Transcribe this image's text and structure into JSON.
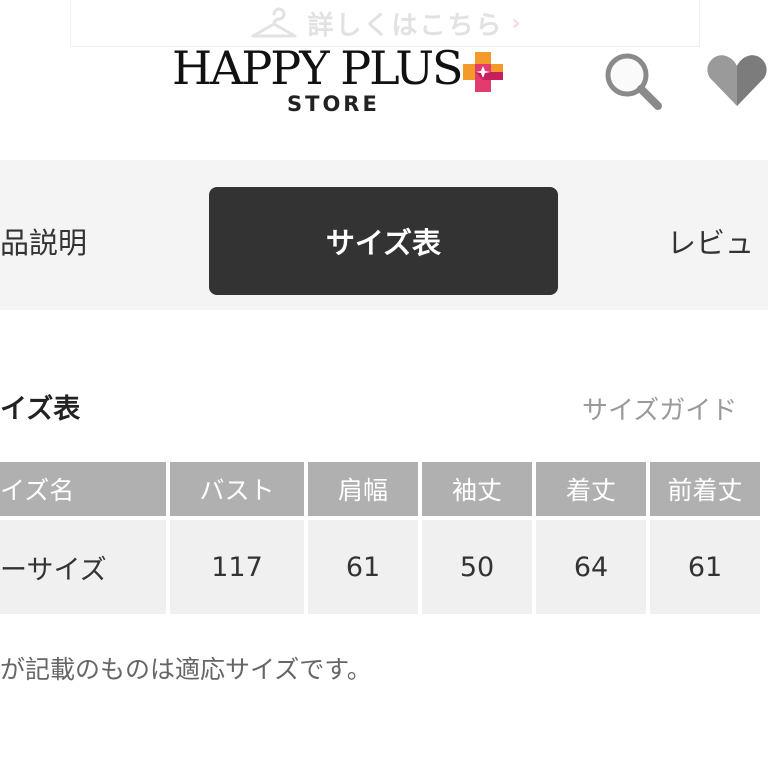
{
  "banner": {
    "text": "詳しくはこちら",
    "arrow": "›"
  },
  "header": {
    "logo_main": "HAPPY PLUS",
    "logo_sub": "STORE",
    "brand_colors": {
      "plus_orange": "#f39a2b",
      "plus_pink": "#e23c6e",
      "plus_magenta": "#c51f5d"
    }
  },
  "tabs": {
    "items": [
      {
        "label": "品説明",
        "active": false
      },
      {
        "label": "サイズ表",
        "active": true
      },
      {
        "label": "レビュ",
        "active": false
      }
    ]
  },
  "section": {
    "title": "イズ表",
    "guide_link": "サイズガイド"
  },
  "size_table": {
    "headers": [
      "イズ名",
      "バスト",
      "肩幅",
      "袖丈",
      "着丈",
      "前着丈"
    ],
    "rows": [
      [
        "ーサイズ",
        "117",
        "61",
        "50",
        "64",
        "61"
      ]
    ]
  },
  "note": "が記載のものは適応サイズです。",
  "colors": {
    "active_tab": "#333333",
    "table_header": "#b0b0b0",
    "table_body": "#f0f0f0",
    "tab_bar": "#f4f4f4"
  }
}
